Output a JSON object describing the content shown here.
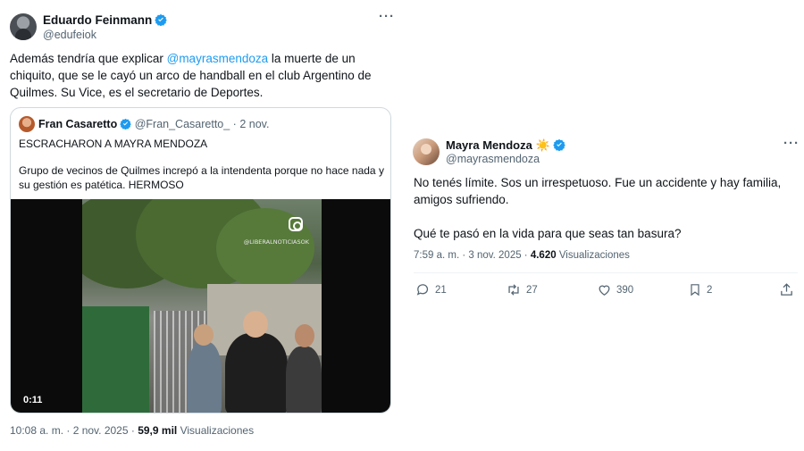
{
  "left_tweet": {
    "author_name": "Eduardo Feinmann",
    "handle": "@edufeiok",
    "text_before_mention": "Además tendría que explicar ",
    "mention": "@mayrasmendoza",
    "text_after_mention": "  la muerte de un chiquito, que se le cayó un arco de handball en el club Argentino de Quilmes. Su Vice, es el secretario de Deportes.",
    "time": "10:08 a. m. · 2 nov. 2025 · ",
    "views_count": "59,9 mil",
    "views_label": " Visualizaciones",
    "quote": {
      "author_name": "Fran Casaretto",
      "handle_date": "@Fran_Casaretto_ · 2 nov.",
      "line1": "ESCRACHARON A MAYRA MENDOZA",
      "line2": "Grupo de vecinos de Quilmes increpó a la intendenta porque no hace nada y su gestión es patética. HERMOSO",
      "video_watermark": "@LIBERALNOTICIASOK",
      "video_duration": "0:11"
    }
  },
  "right_tweet": {
    "author_name": "Mayra Mendoza",
    "name_emoji": "☀️",
    "handle": "@mayrasmendoza",
    "paragraph1": "No tenés límite. Sos un irrespetuoso. Fue un accidente y hay familia, amigos sufriendo.",
    "paragraph2": "Qué te pasó en la vida para que seas tan basura?",
    "time": "7:59 a. m. · 3 nov. 2025 · ",
    "views_count": "4.620",
    "views_label": " Visualizaciones",
    "actions": {
      "replies": "21",
      "reposts": "27",
      "likes": "390",
      "bookmarks": "2"
    }
  },
  "colors": {
    "accent": "#1d9bf0",
    "secondary_text": "#536471",
    "primary_text": "#0f1419",
    "border": "#cfd9de"
  },
  "icons": [
    "verified-badge-icon",
    "more-icon",
    "instagram-icon",
    "reply-icon",
    "repost-icon",
    "like-icon",
    "bookmark-icon",
    "share-icon"
  ]
}
